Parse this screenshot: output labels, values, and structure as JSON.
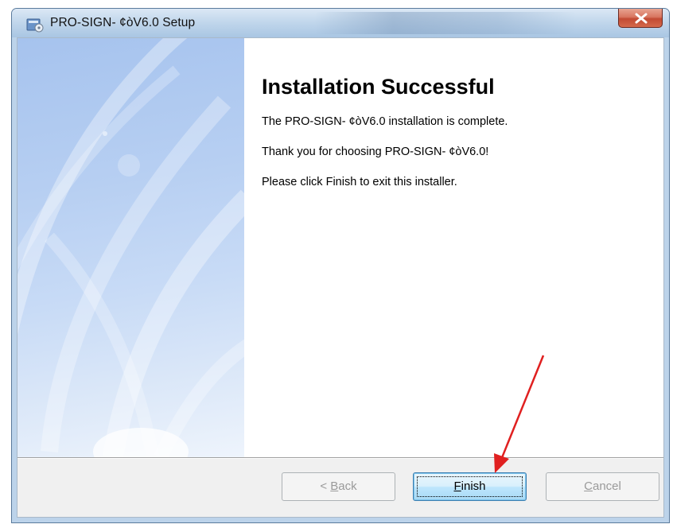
{
  "window": {
    "title": "PRO-SIGN- ¢òV6.0 Setup",
    "close_glyph": "x"
  },
  "content": {
    "heading": "Installation Successful",
    "paragraphs": [
      "The PRO-SIGN- ¢òV6.0  installation is complete.",
      "Thank you for choosing PRO-SIGN- ¢òV6.0!",
      "Please click Finish to exit this installer."
    ]
  },
  "buttons": {
    "back": {
      "mnemonic": "B",
      "rest": "ack",
      "prefix": "< "
    },
    "finish": {
      "mnemonic": "F",
      "rest": "inish"
    },
    "cancel": {
      "mnemonic": "C",
      "rest": "ancel"
    }
  },
  "colors": {
    "annotation_arrow": "#e02020",
    "close_button": "#c24a33",
    "banner": "#a6c3ee"
  },
  "icons": [
    "installer-app-icon",
    "close-icon"
  ]
}
